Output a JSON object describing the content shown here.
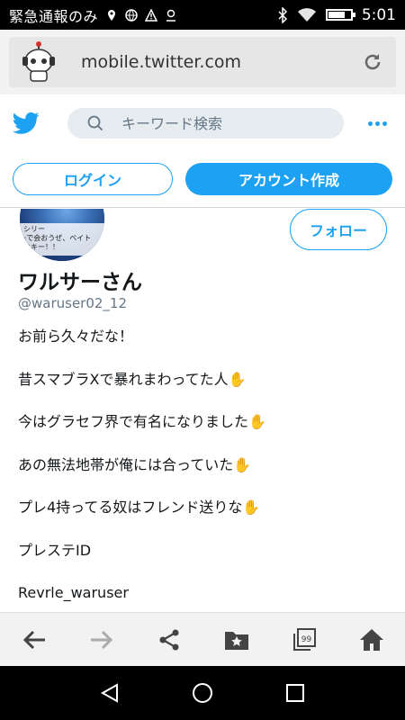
{
  "status_bar": {
    "carrier": "緊急通報のみ",
    "time": "5:01",
    "battery_level": 0.7,
    "icons": [
      "location-icon",
      "globe-icon",
      "warning-icon",
      "map-pin-icon",
      "bluetooth-icon",
      "wifi-icon",
      "battery-icon"
    ]
  },
  "browser": {
    "url": "mobile.twitter.com",
    "reload_icon": "reload-icon"
  },
  "header": {
    "logo_icon": "twitter-bird-icon",
    "search_placeholder": "キーワード検索",
    "more_icon": "more-dots-icon"
  },
  "auth": {
    "login_label": "ログイン",
    "signup_label": "アカウント作成"
  },
  "profile": {
    "follow_label": "フォロー",
    "display_name": "ワルサーさん",
    "handle": "@waruser02_12",
    "avatar_caption_lines": [
      "シリー",
      "‹で会おうぜ、ベイト",
      "のキー！！"
    ],
    "bio_lines": [
      {
        "text": "お前ら久々だな！",
        "hand": ""
      },
      {
        "text": "昔スマブラXで暴れまわってた人",
        "hand": "✋"
      },
      {
        "text": "今はグラセフ界で有名になりました",
        "hand": "✋"
      },
      {
        "text": "あの無法地帯が俺には合っていた",
        "hand": "✋"
      },
      {
        "text": "プレ4持ってる奴はフレンド送りな",
        "hand": "✋"
      },
      {
        "text": "プレステID",
        "hand": ""
      },
      {
        "text": "Revrle_waruser",
        "hand": ""
      }
    ]
  },
  "browser_nav": {
    "items": [
      "back-icon",
      "forward-icon",
      "share-icon",
      "bookmark-folder-icon",
      "tabs-icon",
      "home-icon"
    ],
    "tabs_count": "99"
  },
  "android_nav": {
    "items": [
      "android-back-icon",
      "android-home-icon",
      "android-recents-icon"
    ]
  },
  "colors": {
    "twitter_blue": "#1da1f2",
    "text_primary": "#14171a",
    "text_secondary": "#657786",
    "search_bg": "#e6ecf0"
  }
}
